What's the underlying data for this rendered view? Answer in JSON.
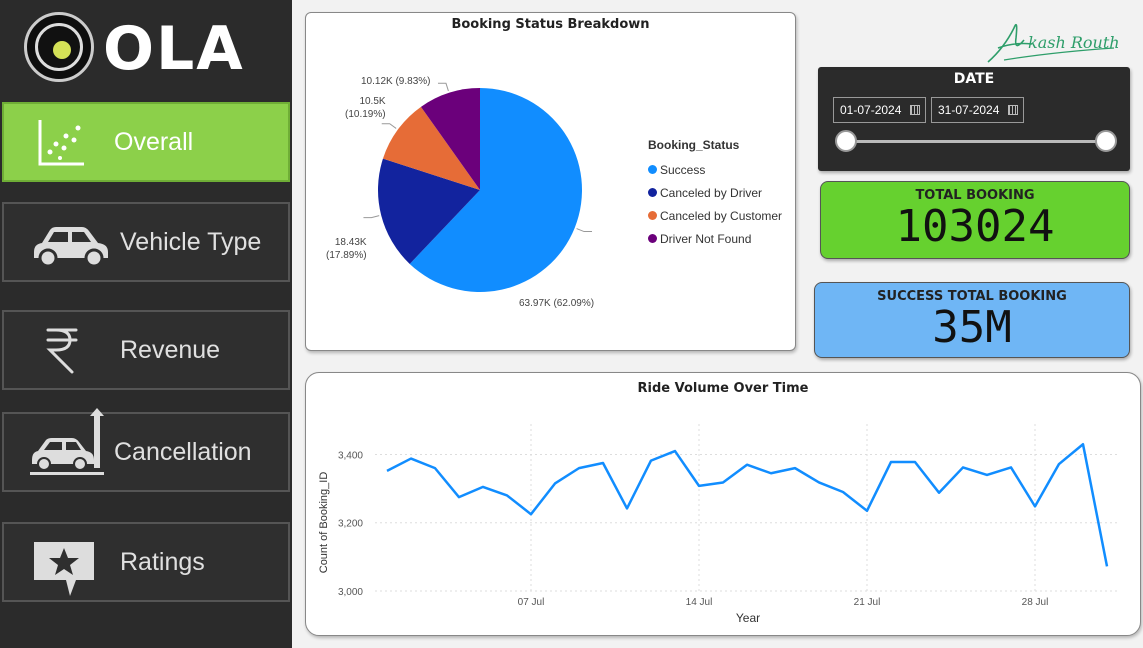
{
  "brand": {
    "logo_text": "OLA",
    "accent": "#8cd04a"
  },
  "nav": [
    {
      "label": "Overall",
      "icon": "scatter-chart-icon",
      "active": true
    },
    {
      "label": "Vehicle Type",
      "icon": "car-icon",
      "active": false
    },
    {
      "label": "Revenue",
      "icon": "rupee-icon",
      "active": false
    },
    {
      "label": "Cancellation",
      "icon": "crash-car-icon",
      "active": false
    },
    {
      "label": "Ratings",
      "icon": "star-badge-icon",
      "active": false
    }
  ],
  "pie": {
    "title": "Booking Status Breakdown",
    "legend_title": "Booking_Status",
    "labels": {
      "success": "63.97K (62.09%)",
      "driver_line1": "18.43K",
      "driver_line2": "(17.89%)",
      "customer_line1": "10.5K",
      "customer_line2": "(10.19%)",
      "notfound": "10.12K (9.83%)"
    }
  },
  "date": {
    "title": "DATE",
    "start": "01-07-2024",
    "end": "31-07-2024"
  },
  "kpis": {
    "total_label": "TOTAL BOOKING",
    "total_value": "103024",
    "success_label": "SUCCESS TOTAL BOOKING",
    "success_value": "35M"
  },
  "signature": {
    "text": "Akash Routh"
  },
  "chart_data": [
    {
      "type": "pie",
      "title": "Booking Status Breakdown",
      "legend_title": "Booking_Status",
      "legend_position": "right",
      "slices": [
        {
          "name": "Success",
          "value": 63970,
          "percent": 62.09,
          "color": "#118dff"
        },
        {
          "name": "Canceled by Driver",
          "value": 18430,
          "percent": 17.89,
          "color": "#12239e"
        },
        {
          "name": "Canceled by Customer",
          "value": 10500,
          "percent": 10.19,
          "color": "#e66c37"
        },
        {
          "name": "Driver Not Found",
          "value": 10120,
          "percent": 9.83,
          "color": "#6b007b"
        }
      ]
    },
    {
      "type": "line",
      "title": "Ride Volume Over Time",
      "xlabel": "Year",
      "ylabel": "Count of Booking_ID",
      "ylim": [
        3000,
        3460
      ],
      "yticks": [
        3000,
        3200,
        3400
      ],
      "ytick_labels": [
        "3,000",
        "3,200",
        "3,400"
      ],
      "xticks": [
        {
          "day": 7,
          "label": "07 Jul"
        },
        {
          "day": 14,
          "label": "14 Jul"
        },
        {
          "day": 21,
          "label": "21 Jul"
        },
        {
          "day": 28,
          "label": "28 Jul"
        }
      ],
      "grid": true,
      "color": "#118dff",
      "x": [
        1,
        2,
        3,
        4,
        5,
        6,
        7,
        8,
        9,
        10,
        11,
        12,
        13,
        14,
        15,
        16,
        17,
        18,
        19,
        20,
        21,
        22,
        23,
        24,
        25,
        26,
        27,
        28,
        29,
        30,
        31
      ],
      "values": [
        3352,
        3388,
        3360,
        3275,
        3305,
        3280,
        3225,
        3315,
        3360,
        3375,
        3242,
        3382,
        3410,
        3308,
        3318,
        3370,
        3345,
        3360,
        3318,
        3290,
        3235,
        3378,
        3378,
        3288,
        3362,
        3340,
        3362,
        3248,
        3372,
        3430,
        3072
      ]
    }
  ]
}
